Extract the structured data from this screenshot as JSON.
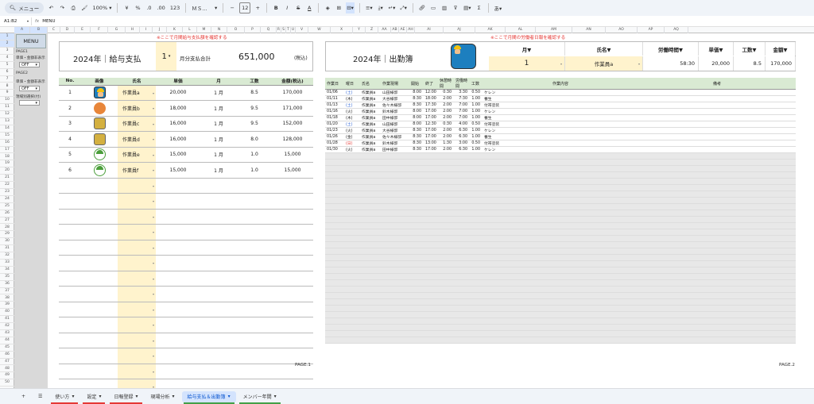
{
  "toolbar": {
    "menu_label": "メニュー",
    "zoom": "100%",
    "currency": "¥",
    "percent": "%",
    "dec_dec": ".0",
    "dec_inc": ".00",
    "num_fmt": "123",
    "font": "ＭＳ...",
    "font_size": "12",
    "sigma": "Σ"
  },
  "formula_bar": {
    "cell_ref": "A1:B2",
    "fx": "fx",
    "content": "MENU"
  },
  "columns": [
    "A",
    "B",
    "C",
    "D",
    "E",
    "F",
    "G",
    "H",
    "I",
    "J",
    "K",
    "L",
    "M",
    "N",
    "O",
    "P",
    "Q",
    "R",
    "S",
    "T",
    "U",
    "V",
    "W",
    "X",
    "Y",
    "Z",
    "AA",
    "AB",
    "AE",
    "AH",
    "AI",
    "AJ",
    "AK",
    "AL",
    "AM",
    "AN",
    "AO",
    "AP",
    "AQ"
  ],
  "rows": [
    "1",
    "2",
    "3",
    "4",
    "5",
    "6",
    "7",
    "8",
    "9",
    "10",
    "11",
    "12",
    "13",
    "14",
    "15",
    "16",
    "17",
    "18",
    "19",
    "20",
    "21",
    "22",
    "23",
    "24",
    "25",
    "26",
    "27",
    "28",
    "29",
    "30",
    "31",
    "32",
    "33",
    "34",
    "35",
    "36",
    "37",
    "38",
    "39",
    "40",
    "41",
    "42",
    "43",
    "44",
    "45",
    "46",
    "47",
    "48",
    "49",
    "50"
  ],
  "side": {
    "menu": "MENU",
    "page1": "PAGE1",
    "page1_opt": "単価・金額非表示",
    "page1_val": "OFF",
    "page2": "PAGE2",
    "page2_opt": "単価・金額非表示",
    "page2_val": "OFF",
    "site": "現場別選択(付)"
  },
  "page1": {
    "note": "※ここで月間給与支払額を確認する",
    "title": "2024年｜給与支払",
    "month": "1",
    "month_label": "月分支払合計",
    "total": "651,000",
    "tax": "(税込)",
    "headers": [
      "No.",
      "画像",
      "氏名",
      "単価",
      "月",
      "工数",
      "金額(税込)"
    ],
    "rows": [
      {
        "no": "1",
        "img": "worker",
        "name": "作業員a",
        "price": "20,000",
        "month": "1 月",
        "hours": "8.5",
        "amount": "170,000"
      },
      {
        "no": "2",
        "img": "orange",
        "name": "作業員b",
        "price": "18,000",
        "month": "1 月",
        "hours": "9.5",
        "amount": "171,000"
      },
      {
        "no": "3",
        "img": "pix",
        "name": "作業員c",
        "price": "16,000",
        "month": "1 月",
        "hours": "9.5",
        "amount": "152,000"
      },
      {
        "no": "4",
        "img": "pix",
        "name": "作業員d",
        "price": "16,000",
        "month": "1 月",
        "hours": "8.0",
        "amount": "128,000"
      },
      {
        "no": "5",
        "img": "green",
        "name": "作業員e",
        "price": "15,000",
        "month": "1 月",
        "hours": "1.0",
        "amount": "15,000"
      },
      {
        "no": "6",
        "img": "green",
        "name": "作業員f",
        "price": "15,000",
        "month": "1 月",
        "hours": "1.0",
        "amount": "15,000"
      }
    ],
    "page_label": "PAGE.1"
  },
  "page2": {
    "note": "※ここで月間の労働者日報を確認する",
    "title": "2024年｜出勤簿",
    "summary_headers": [
      "月▼",
      "氏名▼",
      "労働時間▼",
      "単価▼",
      "工数▼",
      "金額▼"
    ],
    "summary_values": [
      "1",
      "作業員a",
      "58:30",
      "20,000",
      "8.5",
      "170,000"
    ],
    "headers": [
      "作業日",
      "曜日",
      "氏名",
      "作業現場",
      "開始",
      "終了",
      "休憩時間",
      "労働時間",
      "工数",
      "作業内容",
      "備考"
    ],
    "rows": [
      {
        "date": "01/06",
        "dow": "(土)",
        "dc": "blue",
        "name": "作業員a",
        "site": "山田様邸",
        "start": "8:00",
        "end": "12:00",
        "brk": "0:30",
        "work": "3:30",
        "hours": "0.50",
        "task": "ケレン"
      },
      {
        "date": "01/11",
        "dow": "(木)",
        "dc": "",
        "name": "作業員a",
        "site": "大谷様邸",
        "start": "8:30",
        "end": "18:00",
        "brk": "2:00",
        "work": "7:30",
        "hours": "1.00",
        "task": "養生"
      },
      {
        "date": "01/13",
        "dow": "(土)",
        "dc": "blue",
        "name": "作業員a",
        "site": "佐々木様邸",
        "start": "8:30",
        "end": "17:30",
        "brk": "2:00",
        "work": "7:00",
        "hours": "1.00",
        "task": "付帯塗装"
      },
      {
        "date": "01/16",
        "dow": "(火)",
        "dc": "",
        "name": "作業員a",
        "site": "鈴木様邸",
        "start": "8:00",
        "end": "17:00",
        "brk": "2:00",
        "work": "7:00",
        "hours": "1.00",
        "task": "ケレン"
      },
      {
        "date": "01/18",
        "dow": "(木)",
        "dc": "",
        "name": "作業員a",
        "site": "田中様邸",
        "start": "8:00",
        "end": "17:00",
        "brk": "2:00",
        "work": "7:00",
        "hours": "1.00",
        "task": "養生"
      },
      {
        "date": "01/20",
        "dow": "(土)",
        "dc": "blue",
        "name": "作業員a",
        "site": "山田様邸",
        "start": "8:00",
        "end": "12:30",
        "brk": "0:30",
        "work": "4:00",
        "hours": "0.50",
        "task": "付帯塗装"
      },
      {
        "date": "01/23",
        "dow": "(火)",
        "dc": "",
        "name": "作業員a",
        "site": "大谷様邸",
        "start": "8:30",
        "end": "17:00",
        "brk": "2:00",
        "work": "6:30",
        "hours": "1.00",
        "task": "ケレン"
      },
      {
        "date": "01/26",
        "dow": "(金)",
        "dc": "",
        "name": "作業員a",
        "site": "佐々木様邸",
        "start": "8:30",
        "end": "17:00",
        "brk": "2:00",
        "work": "6:30",
        "hours": "1.00",
        "task": "養生"
      },
      {
        "date": "01/28",
        "dow": "(日)",
        "dc": "red",
        "name": "作業員a",
        "site": "鈴木様邸",
        "start": "8:30",
        "end": "13:00",
        "brk": "1:30",
        "work": "3:00",
        "hours": "0.50",
        "task": "付帯塗装"
      },
      {
        "date": "01/30",
        "dow": "(火)",
        "dc": "",
        "name": "作業員a",
        "site": "田中様邸",
        "start": "8:30",
        "end": "17:00",
        "brk": "2:00",
        "work": "6:30",
        "hours": "1.00",
        "task": "ケレン"
      }
    ],
    "page_label": "PAGE.2"
  },
  "tabs": [
    {
      "label": "使い方",
      "color": "#e53935",
      "active": false
    },
    {
      "label": "設定",
      "color": "#e53935",
      "active": false
    },
    {
      "label": "日報登録",
      "color": "#e53935",
      "active": false
    },
    {
      "label": "現場分析",
      "color": "",
      "active": false
    },
    {
      "label": "給与支払＆出勤簿",
      "color": "#43a047",
      "active": true
    },
    {
      "label": "メンバー年間",
      "color": "#43a047",
      "active": false
    }
  ]
}
